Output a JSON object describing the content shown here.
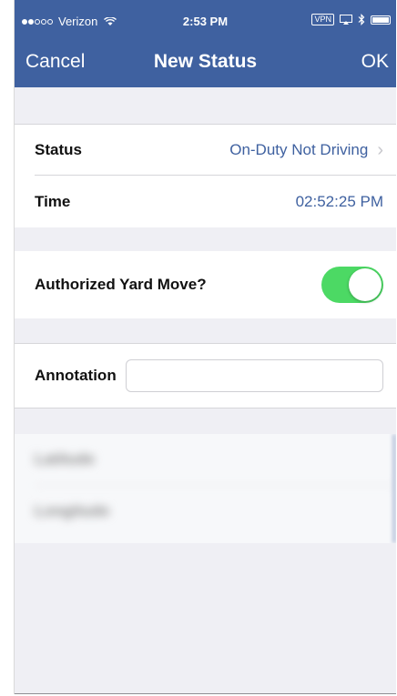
{
  "statusbar": {
    "carrier": "Verizon",
    "time": "2:53 PM",
    "vpn": "VPN"
  },
  "navbar": {
    "cancel": "Cancel",
    "title": "New Status",
    "ok": "OK"
  },
  "form": {
    "status_label": "Status",
    "status_value": "On-Duty Not Driving",
    "time_label": "Time",
    "time_value": "02:52:25 PM",
    "yard_move_label": "Authorized Yard Move?",
    "yard_move_on": true,
    "annotation_label": "Annotation",
    "annotation_value": ""
  },
  "blurred": {
    "row1": "Latitude",
    "row2": "Longitude"
  },
  "colors": {
    "nav": "#3f61a0",
    "toggle_on": "#4cd964"
  }
}
